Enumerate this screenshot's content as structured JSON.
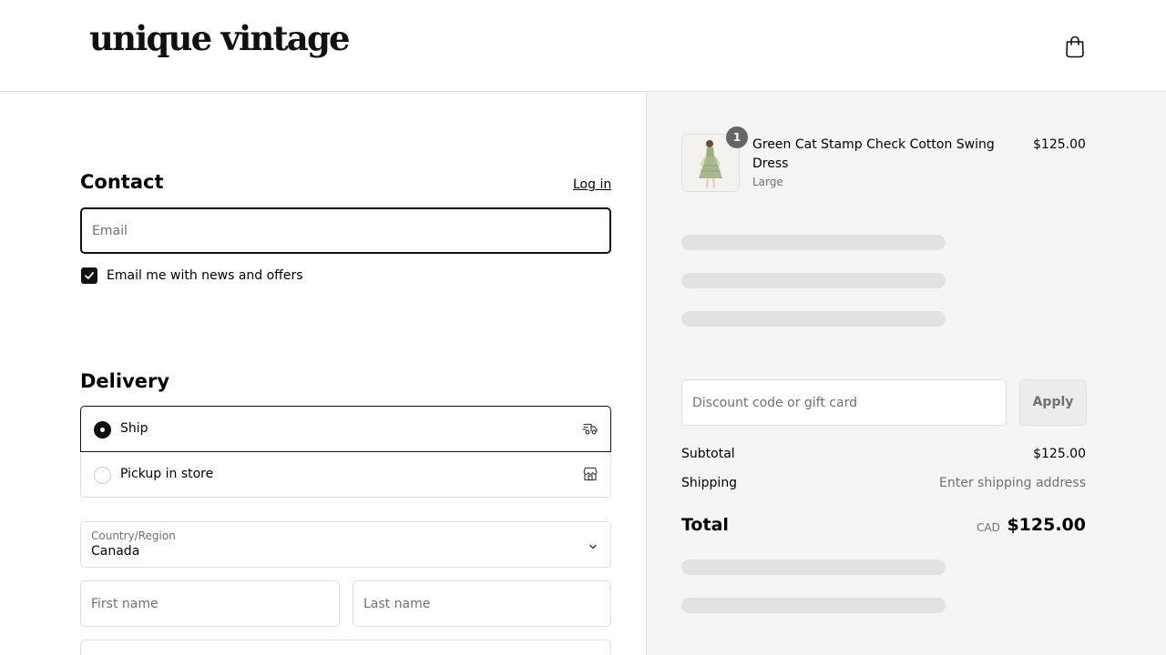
{
  "header": {
    "logo": "unique vintage",
    "cart_icon": "shopping-bag-icon"
  },
  "contact": {
    "title": "Contact",
    "login_label": "Log in",
    "email_placeholder": "Email",
    "newsletter_label": "Email me with news and offers",
    "newsletter_checked": true
  },
  "delivery": {
    "title": "Delivery",
    "options": [
      {
        "label": "Ship",
        "selected": true,
        "icon": "truck-icon"
      },
      {
        "label": "Pickup in store",
        "selected": false,
        "icon": "store-icon"
      }
    ],
    "country_label": "Country/Region",
    "country_value": "Canada",
    "first_name_placeholder": "First name",
    "last_name_placeholder": "Last name"
  },
  "summary": {
    "product": {
      "name": "Green Cat Stamp Check Cotton Swing Dress",
      "variant": "Large",
      "price": "$125.00",
      "quantity": "1"
    },
    "discount_placeholder": "Discount code or gift card",
    "apply_label": "Apply",
    "subtotal_label": "Subtotal",
    "subtotal_value": "$125.00",
    "shipping_label": "Shipping",
    "shipping_value": "Enter shipping address",
    "total_label": "Total",
    "currency": "CAD",
    "total_value": "$125.00"
  },
  "colors": {
    "accent": "#111111",
    "summary_bg": "#f5f5f5",
    "skeleton": "#e2e2e2"
  }
}
